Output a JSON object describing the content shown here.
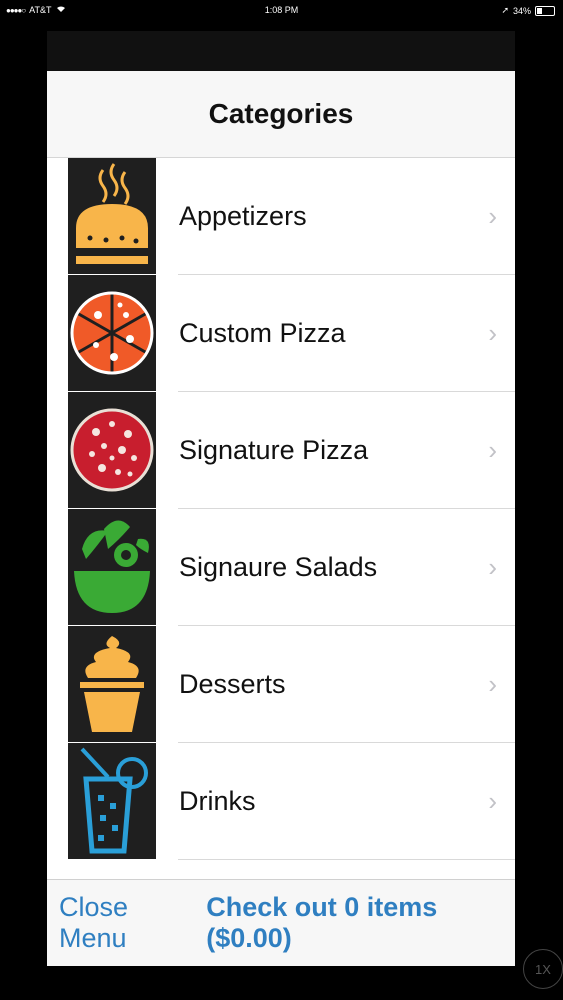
{
  "status_bar": {
    "carrier": "AT&T",
    "time": "1:08 PM",
    "battery": "34%",
    "battery_level": 0.34
  },
  "modal": {
    "title": "Categories"
  },
  "categories": [
    {
      "label": "Appetizers",
      "icon": "bread-icon"
    },
    {
      "label": "Custom Pizza",
      "icon": "pizza-slices-icon"
    },
    {
      "label": "Signature Pizza",
      "icon": "pizza-icon"
    },
    {
      "label": "Signaure Salads",
      "icon": "salad-bowl-icon"
    },
    {
      "label": "Desserts",
      "icon": "cupcake-icon"
    },
    {
      "label": "Drinks",
      "icon": "drink-glass-icon"
    }
  ],
  "bottom": {
    "close_label": "Close Menu",
    "checkout_label": "Check out 0 items ($0.00)"
  },
  "speed_badge": "1X",
  "colors": {
    "accent": "#2f7fc1",
    "bread": "#f8b54a",
    "pizza_orange": "#f05a28",
    "pizza_red": "#c81e2e",
    "salad": "#3aaa35",
    "drink": "#2a9fd8"
  }
}
